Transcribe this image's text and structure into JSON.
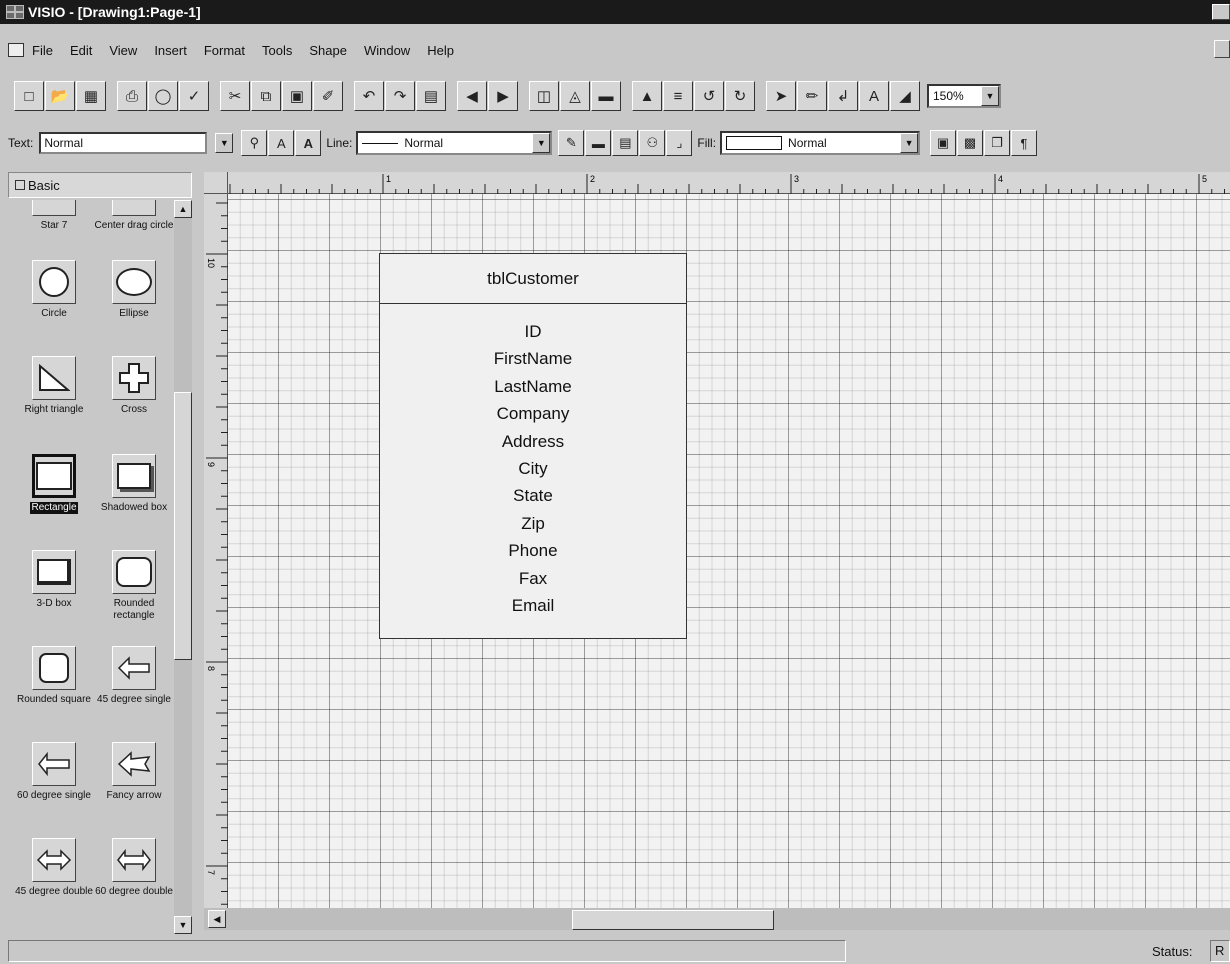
{
  "window": {
    "title": "VISIO - [Drawing1:Page-1]"
  },
  "menubar": {
    "items": [
      "File",
      "Edit",
      "View",
      "Insert",
      "Format",
      "Tools",
      "Shape",
      "Window",
      "Help"
    ]
  },
  "toolbar2": {
    "text_label": "Text:",
    "text_style": "Normal",
    "line_label": "Line:",
    "line_style": "Normal",
    "fill_label": "Fill:",
    "fill_style": "Normal"
  },
  "zoom": "150%",
  "stencil": {
    "title": "Basic",
    "shapes": [
      {
        "label": "Star 7"
      },
      {
        "label": "Center drag circle"
      },
      {
        "label": "Circle"
      },
      {
        "label": "Ellipse"
      },
      {
        "label": "Right triangle"
      },
      {
        "label": "Cross"
      },
      {
        "label": "Rectangle",
        "selected": true
      },
      {
        "label": "Shadowed box"
      },
      {
        "label": "3-D box"
      },
      {
        "label": "Rounded rectangle"
      },
      {
        "label": "Rounded square"
      },
      {
        "label": "45 degree single"
      },
      {
        "label": "60 degree single"
      },
      {
        "label": "Fancy arrow"
      },
      {
        "label": "45 degree double"
      },
      {
        "label": "60 degree double"
      }
    ]
  },
  "ruler": {
    "h_labels": [
      "1",
      "2",
      "3",
      "4",
      "5"
    ],
    "v_labels": [
      "10",
      "9",
      "8",
      "7"
    ]
  },
  "diagram": {
    "table_name": "tblCustomer",
    "fields": [
      "ID",
      "FirstName",
      "LastName",
      "Company",
      "Address",
      "City",
      "State",
      "Zip",
      "Phone",
      "Fax",
      "Email"
    ]
  },
  "statusbar": {
    "status_label": "Status:",
    "pane_text": "R"
  }
}
